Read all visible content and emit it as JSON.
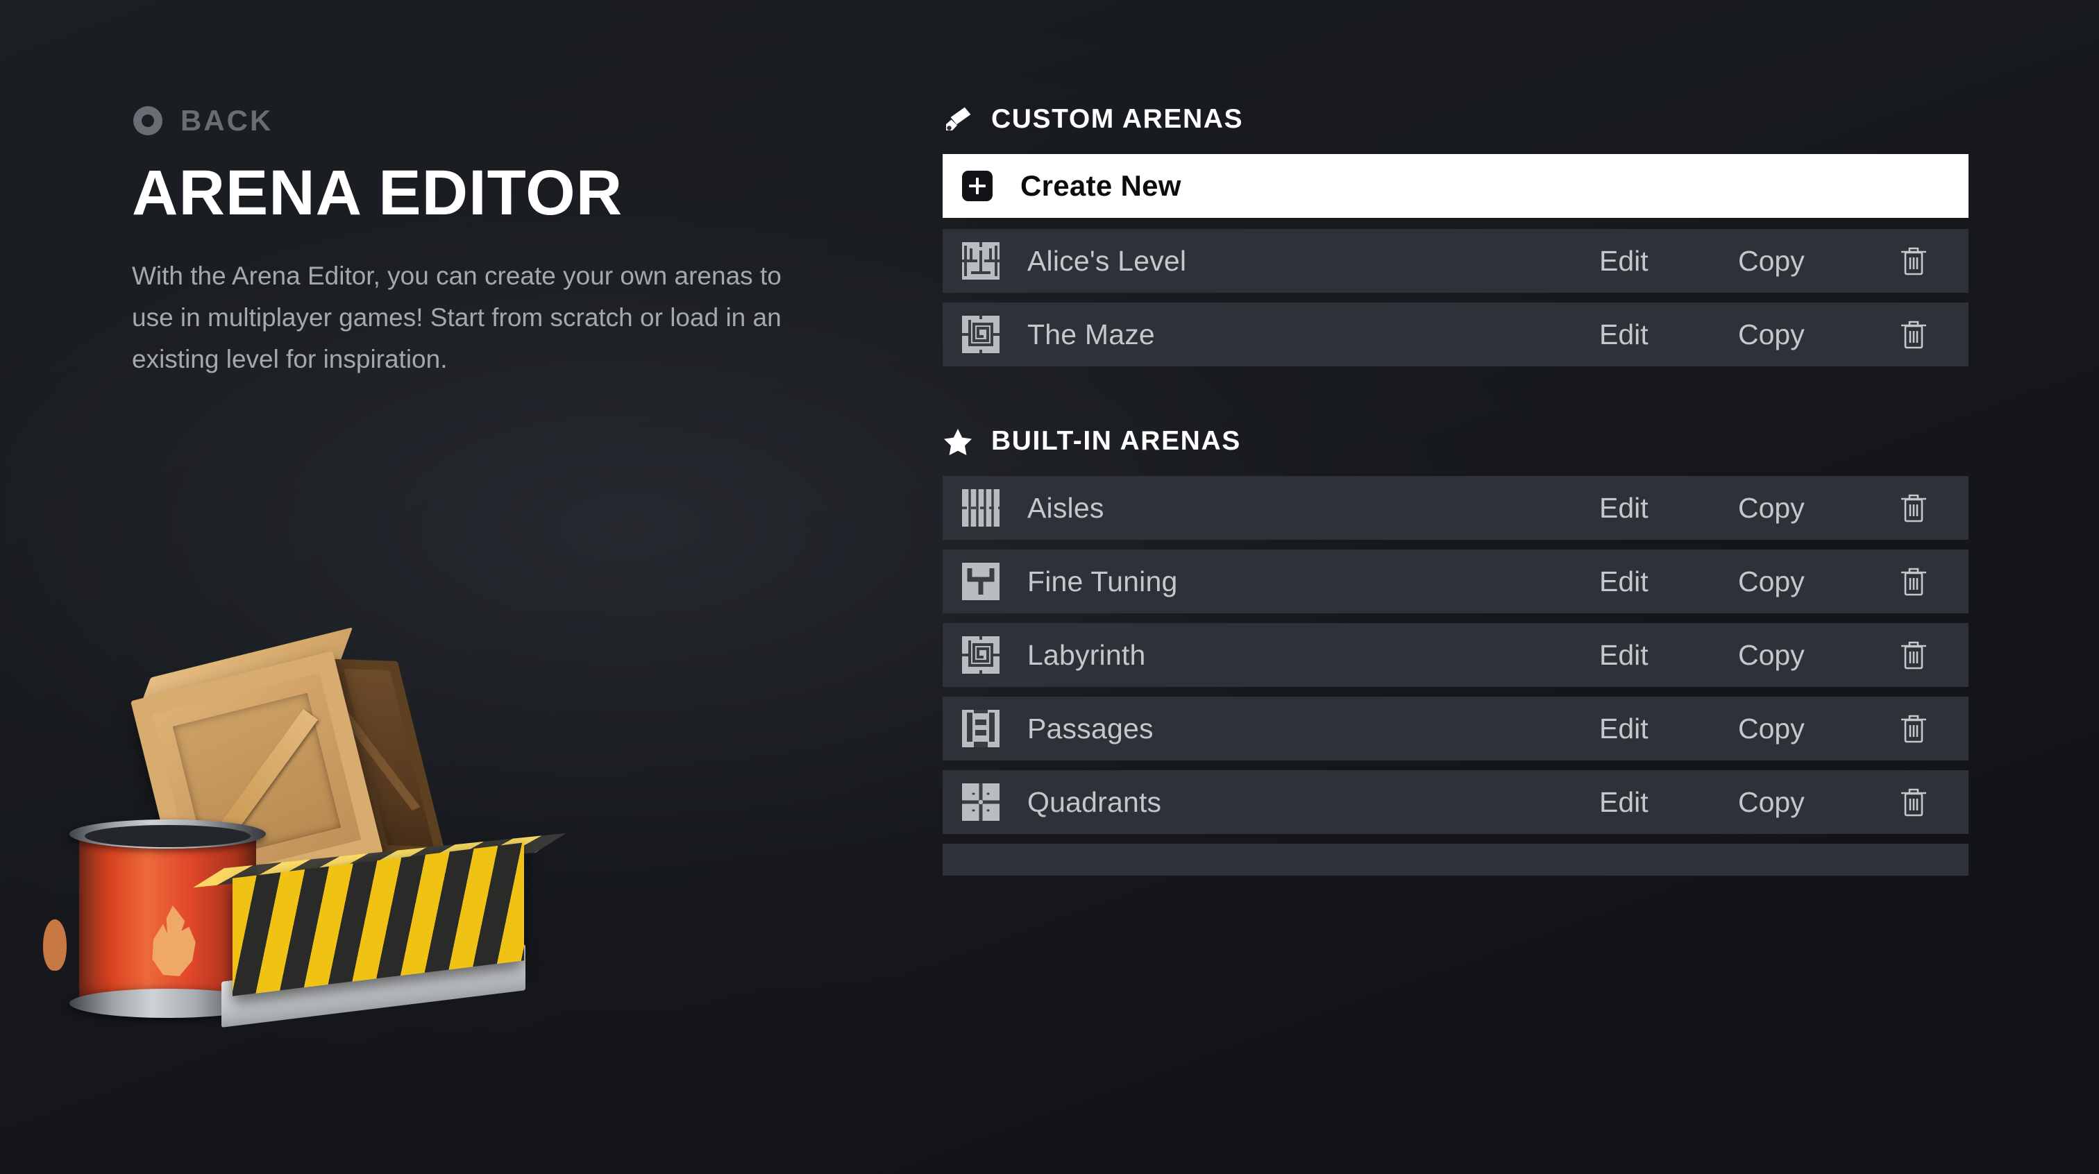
{
  "nav": {
    "back_label": "BACK",
    "back_icon": "target-circle-icon"
  },
  "header": {
    "title": "ARENA EDITOR",
    "description": "With the Arena Editor, you can create your own arenas to use in multiplayer games! Start from scratch or load in an existing level for inspiration."
  },
  "illustration": {
    "props": [
      "wooden-crate",
      "red-fire-barrel",
      "hazard-barrier"
    ]
  },
  "sections": [
    {
      "id": "custom-arenas",
      "label": "CUSTOM ARENAS",
      "icon": "paintbrush-icon"
    },
    {
      "id": "built-in-arenas",
      "label": "BUILT-IN ARENAS",
      "icon": "star-icon"
    }
  ],
  "create": {
    "label": "Create New",
    "icon": "plus-square-icon"
  },
  "actions": {
    "edit_label": "Edit",
    "copy_label": "Copy",
    "delete_icon": "trash-icon"
  },
  "custom_arenas": [
    {
      "name": "Alice's Level",
      "thumb": "rooms-map-icon"
    },
    {
      "name": "The Maze",
      "thumb": "spiral-map-icon"
    }
  ],
  "built_in_arenas": [
    {
      "name": "Aisles",
      "thumb": "aisles-map-icon"
    },
    {
      "name": "Fine Tuning",
      "thumb": "tuning-fork-map-icon"
    },
    {
      "name": "Labyrinth",
      "thumb": "spiral-map-icon"
    },
    {
      "name": "Passages",
      "thumb": "passages-map-icon"
    },
    {
      "name": "Quadrants",
      "thumb": "quadrants-map-icon"
    }
  ],
  "colors": {
    "background": "#15171b",
    "row": "#2e3137",
    "row_gap": "#212429",
    "create_row": "#ffffff",
    "accent_text": "#c4c7cb",
    "title": "#ffffff",
    "muted": "#6a6e74",
    "thumb": "#b9bcc0"
  }
}
